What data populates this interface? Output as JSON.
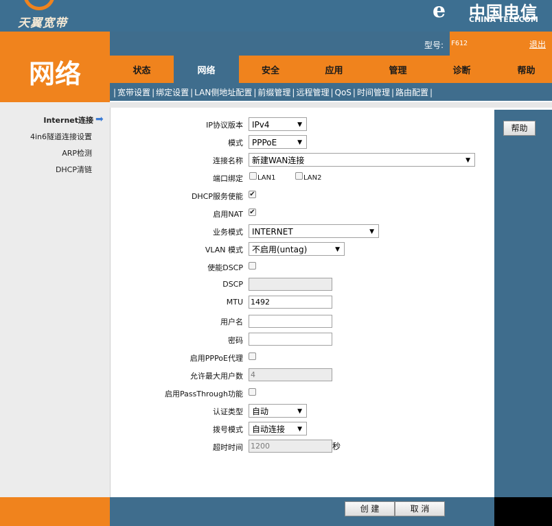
{
  "brand": {
    "name": "天翼宽带",
    "telecom_cn": "中国电信",
    "telecom_en": "CHINA TELECOM",
    "logo_glyph": "e"
  },
  "header": {
    "page_title": "网络",
    "model_label": "型号:",
    "model_value": "F612",
    "logout": "退出"
  },
  "tabs": [
    {
      "label": "状态"
    },
    {
      "label": "网络",
      "active": true
    },
    {
      "label": "安全"
    },
    {
      "label": "应用"
    },
    {
      "label": "管理"
    },
    {
      "label": "诊断"
    },
    {
      "label": "帮助"
    }
  ],
  "subnav": [
    "宽带设置",
    "绑定设置",
    "LAN侧地址配置",
    "前缀管理",
    "远程管理",
    "QoS",
    "时间管理",
    "路由配置"
  ],
  "sidebar": {
    "items": [
      {
        "label": "Internet连接",
        "active": true
      },
      {
        "label": "4in6隧道连接设置"
      },
      {
        "label": "ARP检测"
      },
      {
        "label": "DHCP清链"
      }
    ]
  },
  "form": {
    "ip_version": {
      "label": "IP协议版本",
      "value": "IPv4"
    },
    "mode": {
      "label": "模式",
      "value": "PPPoE"
    },
    "connection_name": {
      "label": "连接名称",
      "value": "新建WAN连接"
    },
    "port_binding": {
      "label": "端口绑定",
      "lan1": "LAN1",
      "lan2": "LAN2",
      "lan1_checked": false,
      "lan2_checked": false
    },
    "dhcp_enable": {
      "label": "DHCP服务使能",
      "checked": true
    },
    "nat_enable": {
      "label": "启用NAT",
      "checked": true
    },
    "service_mode": {
      "label": "业务模式",
      "value": "INTERNET"
    },
    "vlan_mode": {
      "label": "VLAN 模式",
      "value": "不启用(untag)"
    },
    "dscp_enable": {
      "label": "使能DSCP",
      "checked": false
    },
    "dscp": {
      "label": "DSCP",
      "value": ""
    },
    "mtu": {
      "label": "MTU",
      "value": "1492"
    },
    "username": {
      "label": "用户名",
      "value": ""
    },
    "password": {
      "label": "密码",
      "value": ""
    },
    "pppoe_proxy": {
      "label": "启用PPPoE代理",
      "checked": false
    },
    "max_users": {
      "label": "允许最大用户数",
      "value": "4"
    },
    "passthrough": {
      "label": "启用PassThrough功能",
      "checked": false
    },
    "auth_type": {
      "label": "认证类型",
      "value": "自动"
    },
    "dial_mode": {
      "label": "拨号模式",
      "value": "自动连接"
    },
    "timeout": {
      "label": "超时时间",
      "value": "1200",
      "unit": "秒"
    }
  },
  "buttons": {
    "create": "创 建",
    "cancel": "取 消",
    "help": "帮助"
  },
  "colors": {
    "orange": "#f0831d",
    "blue": "#3f6d8d"
  }
}
